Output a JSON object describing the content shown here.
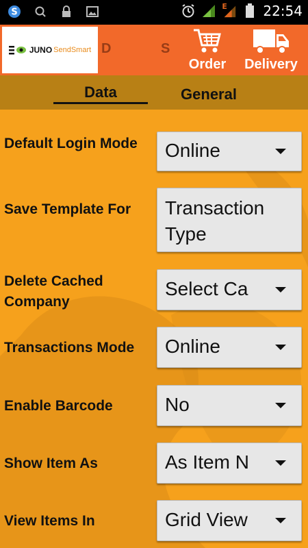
{
  "status_bar": {
    "time": "22:54",
    "network_label": "E",
    "icons": [
      "skype-icon",
      "search-icon",
      "lock-icon",
      "image-icon",
      "alarm-icon",
      "signal-icon",
      "signal-edge-icon",
      "battery-icon"
    ]
  },
  "app_bar": {
    "logo_brand": "JUNO",
    "logo_product": "SendSmart",
    "ghost_left": "D",
    "ghost_right": "S",
    "order_label": "Order",
    "delivery_label": "Delivery",
    "accent_color": "#F2692A"
  },
  "tabs": [
    {
      "label": "Data",
      "selected": true
    },
    {
      "label": "General",
      "selected": false
    }
  ],
  "settings": {
    "default_login_mode": {
      "label": "Default Login Mode",
      "value": "Online"
    },
    "save_template_for": {
      "label": "Save Template For",
      "value": "Transaction Type"
    },
    "delete_cached_company": {
      "label": "Delete Cached Company",
      "value": "Select Ca"
    },
    "transactions_mode": {
      "label": "Transactions Mode",
      "value": "Online"
    },
    "enable_barcode": {
      "label": "Enable Barcode",
      "value": "No"
    },
    "show_item_as": {
      "label": "Show Item As",
      "value": "As Item N"
    },
    "view_items_in": {
      "label": "View Items In",
      "value": "Grid View"
    }
  },
  "colors": {
    "background": "#F6A11C",
    "tab_bar": "#B88015",
    "status_bar": "#000000",
    "spinner": "#E7E7E7"
  }
}
